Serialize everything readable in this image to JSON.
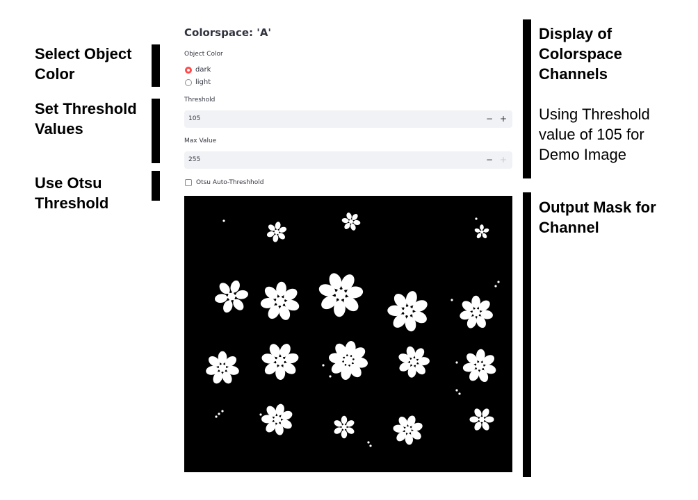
{
  "annotations": {
    "left": [
      {
        "label": "Select Object\nColor"
      },
      {
        "label": "Set Threshold\nValues"
      },
      {
        "label": "Use Otsu\nThreshold"
      }
    ],
    "right": {
      "display_heading": "Display of\nColorspace\nChannels",
      "threshold_note": "Using Threshold\nvalue of 105 for\nDemo Image",
      "output_heading": "Output Mask for\nChannel"
    }
  },
  "app": {
    "title": "Colorspace: 'A'",
    "object_color": {
      "label": "Object Color",
      "options": [
        {
          "label": "dark",
          "selected": true
        },
        {
          "label": "light",
          "selected": false
        }
      ]
    },
    "threshold": {
      "label": "Threshold",
      "value": "105"
    },
    "max_value": {
      "label": "Max Value",
      "value": "255"
    },
    "stepper": {
      "minus": "−",
      "plus": "+"
    },
    "otsu": {
      "label": "Otsu Auto-Threshhold",
      "checked": false
    },
    "accent_color": "#ff4b4b",
    "mask_image": {
      "background": "#000000",
      "foreground": "#ffffff"
    }
  }
}
